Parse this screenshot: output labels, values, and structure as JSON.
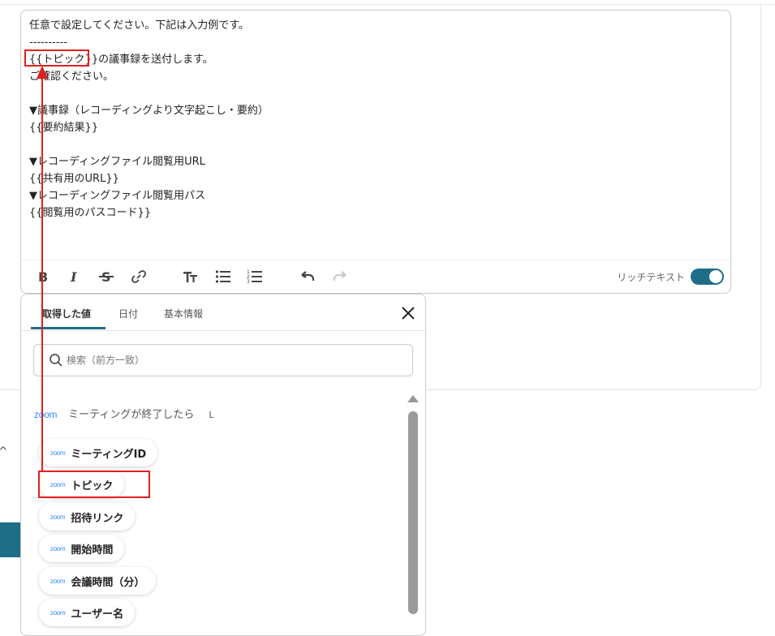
{
  "editor": {
    "lines": [
      "任意で設定してください。下記は入力例です。",
      "----------",
      "{{トピック}}の議事録を送付します。",
      "ご確認ください。",
      "",
      "▼議事録（レコーディングより文字起こし・要約）",
      "{{要約結果}}",
      "",
      "▼レコーディングファイル閲覧用URL",
      "{{共有用のURL}}",
      "▼レコーディングファイル閲覧用パス",
      "{{閲覧用のパスコード}}"
    ],
    "toolbar": {
      "rich_text_label": "リッチテキスト",
      "rich_text_enabled": true
    }
  },
  "popup": {
    "tabs": [
      {
        "label": "取得した値",
        "active": true
      },
      {
        "label": "日付",
        "active": false
      },
      {
        "label": "基本情報",
        "active": false
      }
    ],
    "search": {
      "placeholder": "検索（前方一致）",
      "value": ""
    },
    "section": {
      "logo": "zoom",
      "title": "ミーティングが終了したら",
      "corner": "L"
    },
    "items": [
      {
        "logo": "zoom",
        "label": "ミーティングID"
      },
      {
        "logo": "zoom",
        "label": "トピック"
      },
      {
        "logo": "zoom",
        "label": "招待リンク"
      },
      {
        "logo": "zoom",
        "label": "開始時間"
      },
      {
        "logo": "zoom",
        "label": "会議時間（分）"
      },
      {
        "logo": "zoom",
        "label": "ユーザー名"
      }
    ]
  },
  "colors": {
    "accent": "#1d6e86",
    "highlight": "#e02020",
    "zoom": "#2D8CFF"
  }
}
